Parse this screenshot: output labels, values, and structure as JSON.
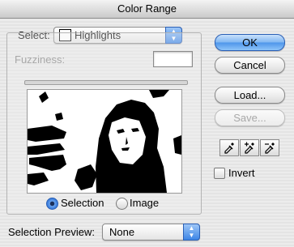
{
  "window": {
    "title": "Color Range"
  },
  "select": {
    "label": "Select:",
    "value": "Highlights"
  },
  "fuzziness": {
    "label": "Fuzziness:",
    "value": ""
  },
  "preview_mode": {
    "selection_label": "Selection",
    "image_label": "Image",
    "selected": "Selection"
  },
  "selection_preview": {
    "label": "Selection Preview:",
    "value": "None"
  },
  "buttons": {
    "ok": "OK",
    "cancel": "Cancel",
    "load": "Load...",
    "save": "Save..."
  },
  "eyedroppers": [
    "eyedropper-icon",
    "eyedropper-plus-icon",
    "eyedropper-minus-icon"
  ],
  "invert": {
    "label": "Invert",
    "checked": false
  },
  "colors": {
    "accent": "#3d86e6",
    "disabled_text": "#a8a8a8"
  }
}
